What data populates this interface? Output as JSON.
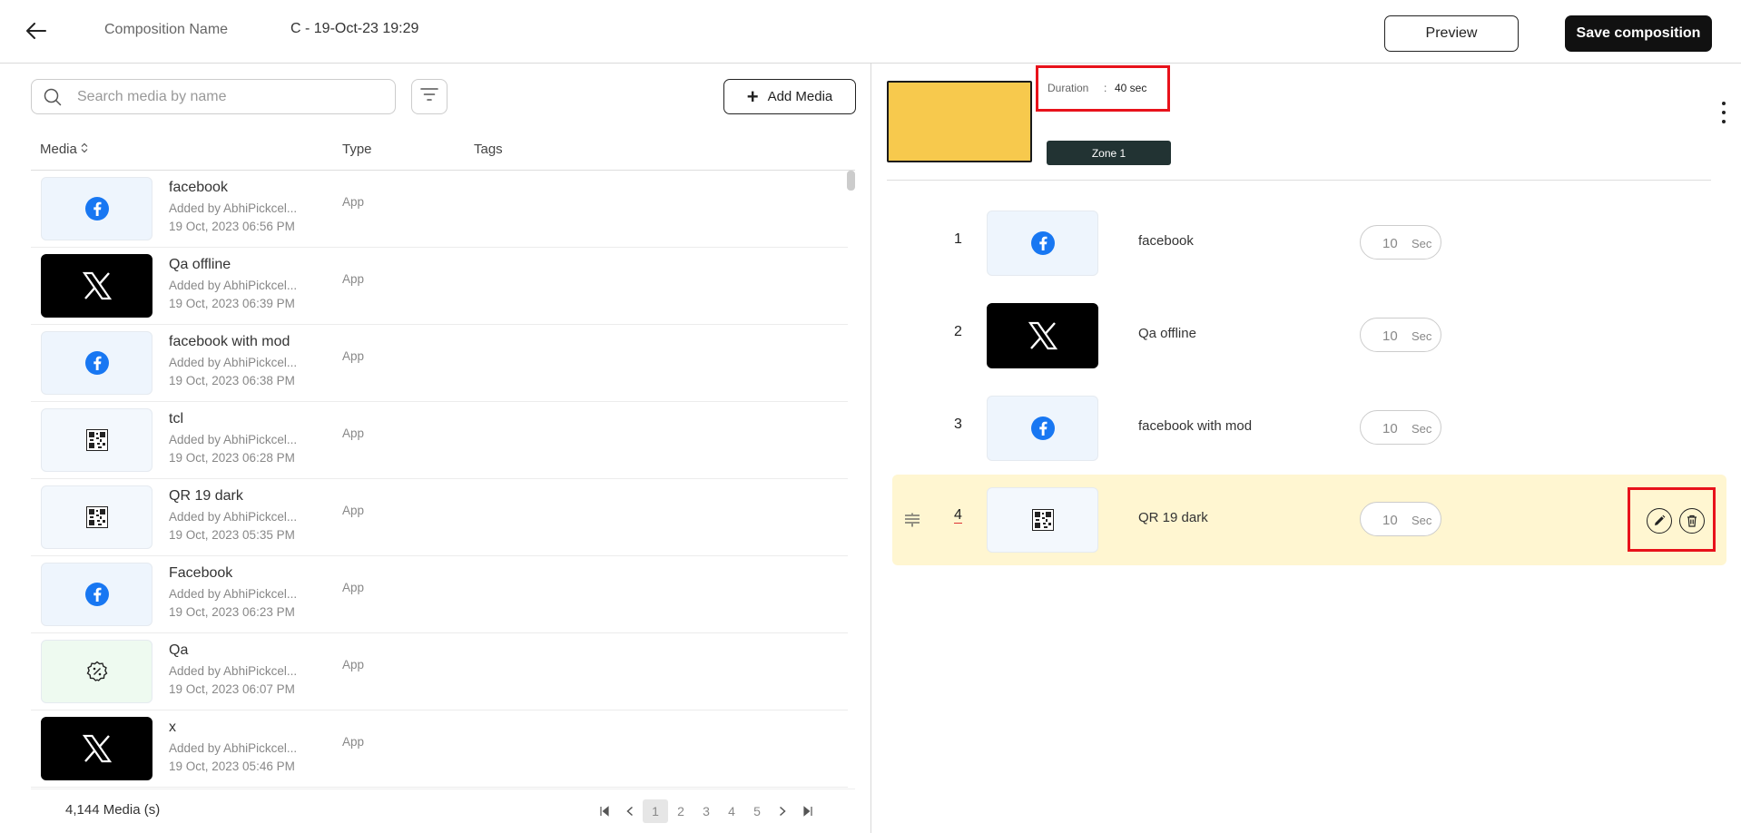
{
  "header": {
    "composition_label": "Composition Name",
    "composition_value": "C - 19-Oct-23 19:29",
    "preview_label": "Preview",
    "save_label": "Save composition"
  },
  "left_panel": {
    "search_placeholder": "Search media by name",
    "add_media_label": "Add Media",
    "columns": {
      "media": "Media",
      "type": "Type",
      "tags": "Tags"
    },
    "media_items": [
      {
        "name": "facebook",
        "added": "Added by AbhiPickcel...",
        "date": "19 Oct, 2023 06:56 PM",
        "type": "App",
        "icon": "facebook-icon"
      },
      {
        "name": "Qa offline",
        "added": "Added by AbhiPickcel...",
        "date": "19 Oct, 2023 06:39 PM",
        "type": "App",
        "icon": "x-logo-icon"
      },
      {
        "name": "facebook with mod",
        "added": "Added by AbhiPickcel...",
        "date": "19 Oct, 2023 06:38 PM",
        "type": "App",
        "icon": "facebook-icon"
      },
      {
        "name": "tcl",
        "added": "Added by AbhiPickcel...",
        "date": "19 Oct, 2023 06:28 PM",
        "type": "App",
        "icon": "qr-code-icon"
      },
      {
        "name": "QR 19 dark",
        "added": "Added by AbhiPickcel...",
        "date": "19 Oct, 2023 05:35 PM",
        "type": "App",
        "icon": "qr-code-icon"
      },
      {
        "name": "Facebook",
        "added": "Added by AbhiPickcel...",
        "date": "19 Oct, 2023 06:23 PM",
        "type": "App",
        "icon": "facebook-icon"
      },
      {
        "name": "Qa",
        "added": "Added by AbhiPickcel...",
        "date": "19 Oct, 2023 06:07 PM",
        "type": "App",
        "icon": "badge-icon"
      },
      {
        "name": "x",
        "added": "Added by AbhiPickcel...",
        "date": "19 Oct, 2023 05:46 PM",
        "type": "App",
        "icon": "x-logo-icon"
      }
    ],
    "media_count": "4,144 Media (s)",
    "pagination": {
      "pages": [
        "1",
        "2",
        "3",
        "4",
        "5"
      ],
      "current": "1"
    }
  },
  "right_panel": {
    "duration_label": "Duration",
    "duration_sep": ":",
    "duration_value": "40 sec",
    "zone_label": "Zone 1",
    "zone_color": "#f7c94d",
    "sequence": [
      {
        "index": "1",
        "name": "facebook",
        "seconds": "10",
        "unit": "Sec",
        "icon": "facebook-icon"
      },
      {
        "index": "2",
        "name": "Qa offline",
        "seconds": "10",
        "unit": "Sec",
        "icon": "x-logo-icon"
      },
      {
        "index": "3",
        "name": "facebook with mod",
        "seconds": "10",
        "unit": "Sec",
        "icon": "facebook-icon"
      },
      {
        "index": "4",
        "name": "QR 19 dark",
        "seconds": "10",
        "unit": "Sec",
        "icon": "qr-code-icon"
      }
    ]
  },
  "colors": {
    "facebook_blue": "#1877f2",
    "highlight_red": "#e8121b",
    "selected_row": "#fff6d1",
    "zone_button": "#223333"
  }
}
